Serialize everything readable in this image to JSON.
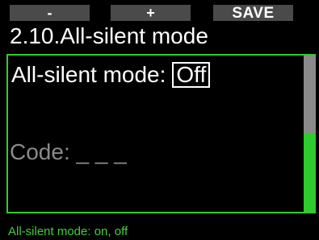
{
  "softkeys": {
    "minus": "-",
    "plus": "+",
    "save": "SAVE"
  },
  "title": "2.10.All-silent mode",
  "setting": {
    "label": "All-silent mode:",
    "value": "Off"
  },
  "code": {
    "label": "Code:",
    "value": "_ _ _"
  },
  "hint": "All-silent mode: on, off",
  "colors": {
    "accent": "#2ecc2e",
    "softkey_bg": "#4a4a4a",
    "muted_text": "#8a8a8a",
    "background": "#000000"
  }
}
